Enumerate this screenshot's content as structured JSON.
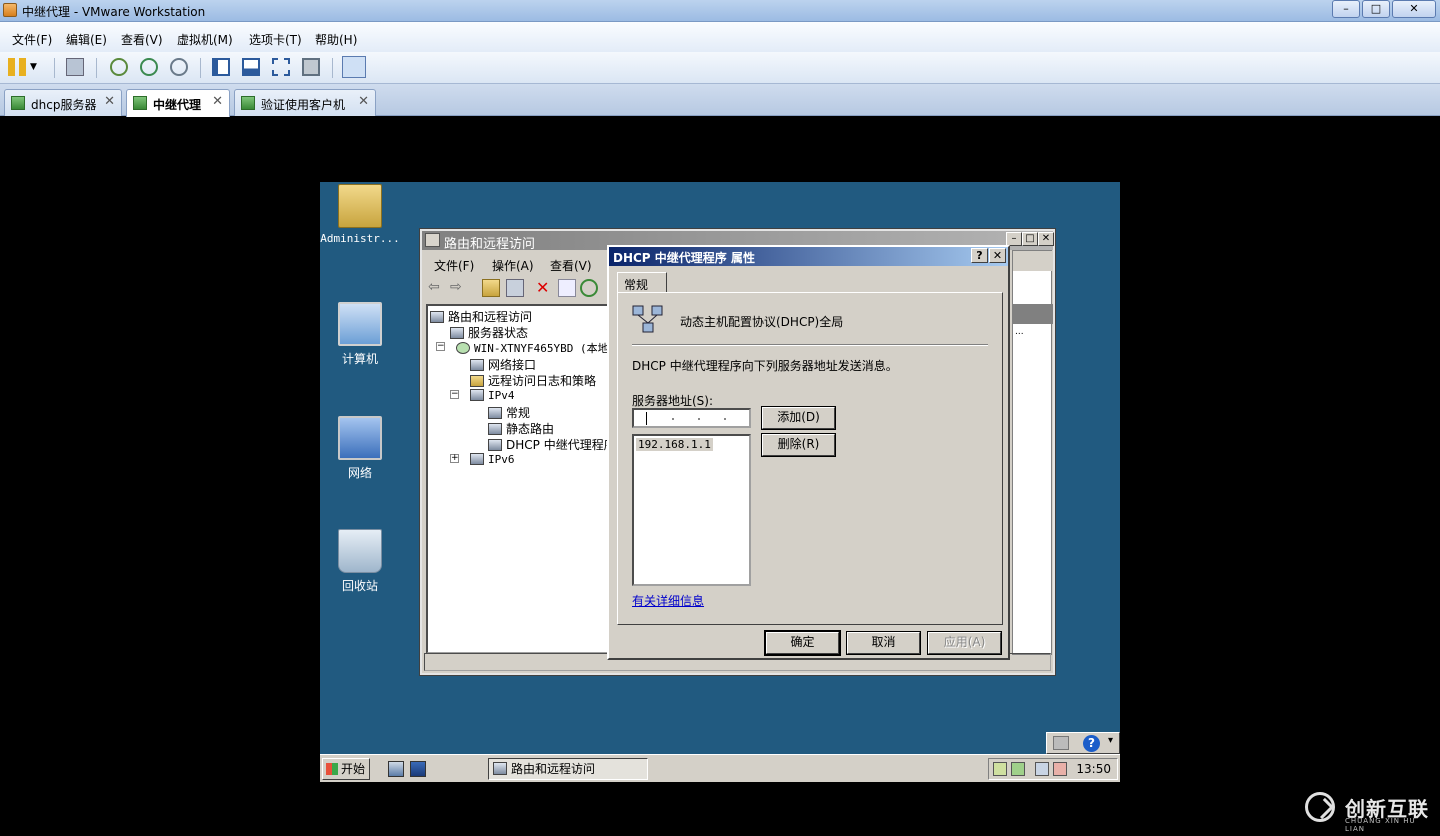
{
  "host": {
    "title": "中继代理 - VMware Workstation",
    "menu": [
      "文件(F)",
      "编辑(E)",
      "查看(V)",
      "虚拟机(M)",
      "选项卡(T)",
      "帮助(H)"
    ],
    "tabs": [
      {
        "label": "dhcp服务器",
        "active": false
      },
      {
        "label": "中继代理",
        "active": true
      },
      {
        "label": "验证使用客户机",
        "active": false
      }
    ],
    "close_glyph": "✕",
    "min_glyph": "–",
    "max_glyph": "□"
  },
  "desktop": {
    "icons": [
      "Administr...",
      "计算机",
      "网络",
      "回收站"
    ]
  },
  "rra_window": {
    "title": "路由和远程访问",
    "menu": [
      "文件(F)",
      "操作(A)",
      "查看(V)"
    ],
    "tree": [
      "路由和远程访问",
      "服务器状态",
      "WIN-XTNYF465YBD (本地)",
      "网络接口",
      "远程访问日志和策略",
      "IPv4",
      "常规",
      "静态路由",
      "DHCP 中继代理程序",
      "IPv6"
    ],
    "right_fragment": "..."
  },
  "dialog": {
    "title": "DHCP 中继代理程序 属性",
    "help_glyph": "?",
    "close_glyph": "✕",
    "tab": "常规",
    "header": "动态主机配置协议(DHCP)全局",
    "description": "DHCP 中继代理程序向下列服务器地址发送消息。",
    "address_label": "服务器地址(S):",
    "add_button": "添加(D)",
    "remove_button": "删除(R)",
    "addresses": [
      "192.168.1.1"
    ],
    "more_info_link": "有关详细信息",
    "ok_button": "确定",
    "cancel_button": "取消",
    "apply_button": "应用(A)"
  },
  "taskbar": {
    "start_label": "开始",
    "task_label": "路由和远程访问",
    "clock": "13:50"
  },
  "watermark": {
    "brand": "创新互联",
    "sub": "CHUANG XIN HU LIAN"
  }
}
